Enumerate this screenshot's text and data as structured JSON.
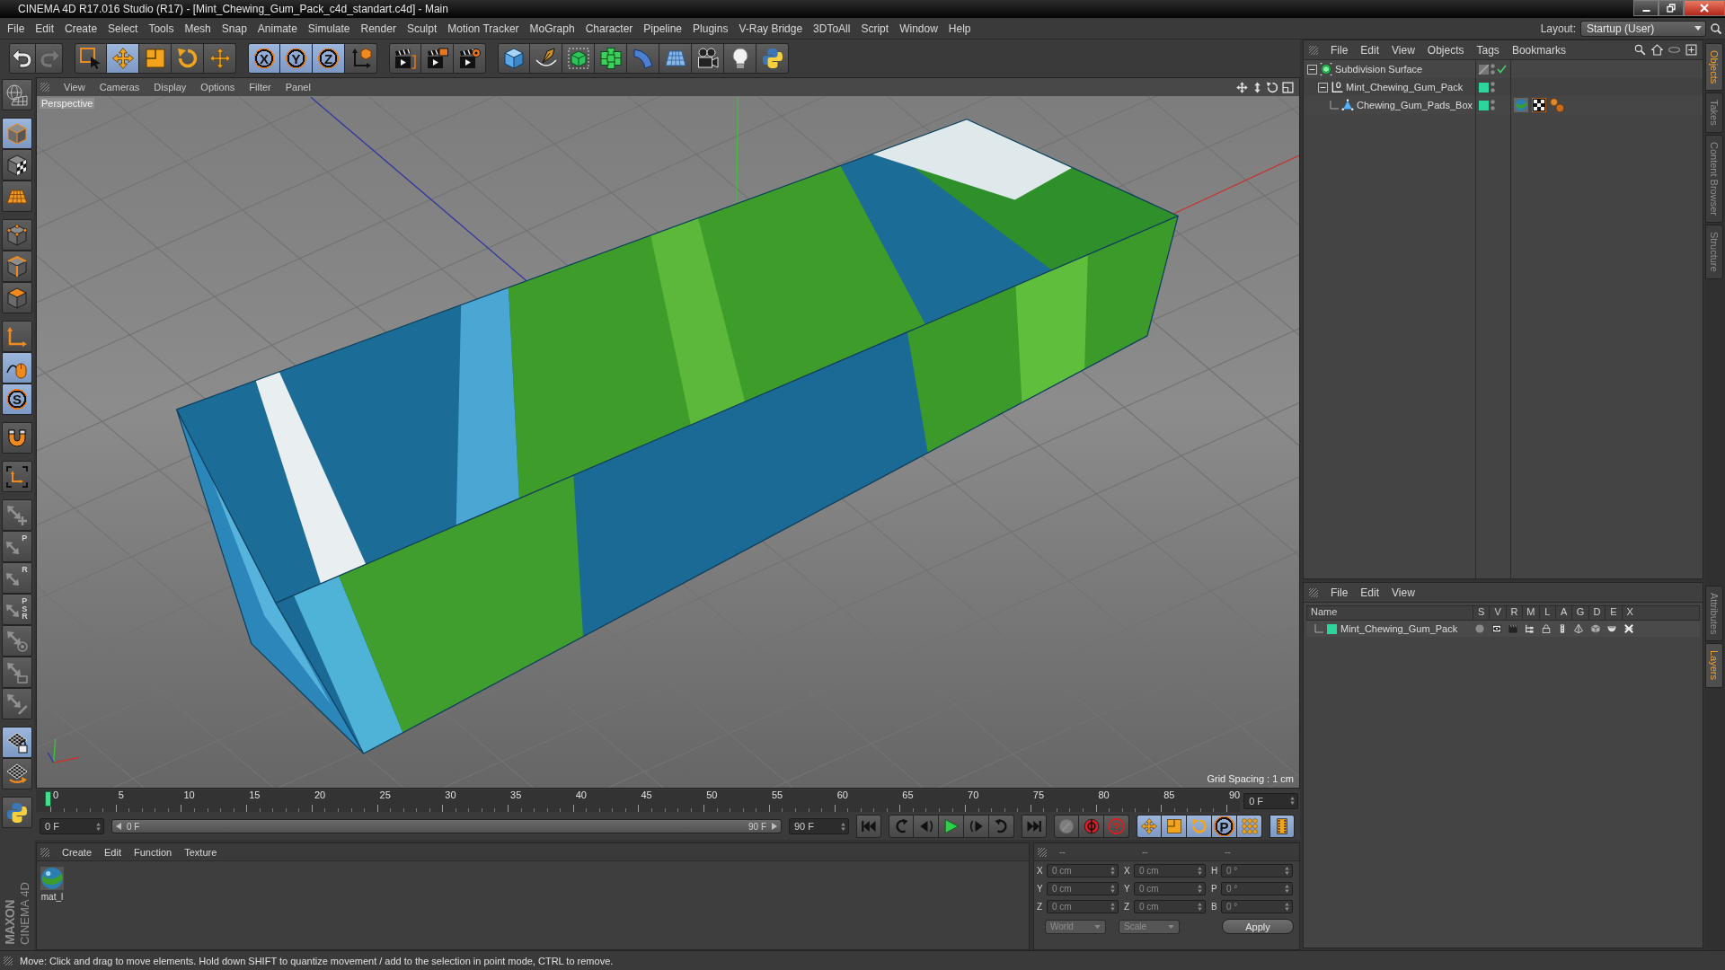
{
  "window": {
    "title": "CINEMA 4D R17.016 Studio (R17) - [Mint_Chewing_Gum_Pack_c4d_standart.c4d] - Main"
  },
  "menu_bar": [
    "File",
    "Edit",
    "Create",
    "Select",
    "Tools",
    "Mesh",
    "Snap",
    "Animate",
    "Simulate",
    "Render",
    "Sculpt",
    "Motion Tracker",
    "MoGraph",
    "Character",
    "Pipeline",
    "Plugins",
    "V-Ray Bridge",
    "3DToAll",
    "Script",
    "Window",
    "Help"
  ],
  "layout": {
    "label": "Layout:",
    "value": "Startup (User)"
  },
  "toolbar": [
    [
      {
        "kind": "undo",
        "selected": false,
        "disabled": false
      },
      {
        "kind": "redo",
        "selected": false,
        "disabled": true
      }
    ],
    [
      {
        "kind": "live-selection",
        "selected": false,
        "disabled": false
      },
      {
        "kind": "move",
        "selected": true,
        "disabled": false
      },
      {
        "kind": "scale",
        "selected": false,
        "disabled": false
      },
      {
        "kind": "rotate",
        "selected": false,
        "disabled": false
      },
      {
        "kind": "last-tool",
        "selected": false,
        "disabled": false
      }
    ],
    [
      {
        "kind": "axis-lock",
        "label": "X",
        "selected": true,
        "disabled": false
      },
      {
        "kind": "axis-lock",
        "label": "Y",
        "selected": true,
        "disabled": false
      },
      {
        "kind": "axis-lock",
        "label": "Z",
        "selected": true,
        "disabled": false
      },
      {
        "kind": "coordinate-system",
        "selected": false,
        "disabled": false
      }
    ],
    [
      {
        "kind": "render-view",
        "selected": false,
        "disabled": false
      },
      {
        "kind": "render-viewer",
        "selected": false,
        "disabled": false
      },
      {
        "kind": "render-settings",
        "selected": false,
        "disabled": false
      }
    ],
    [
      {
        "kind": "cube",
        "selected": false,
        "disabled": false
      },
      {
        "kind": "pen",
        "selected": false,
        "disabled": false
      },
      {
        "kind": "subdivision",
        "selected": false,
        "disabled": false
      },
      {
        "kind": "cloner",
        "selected": false,
        "disabled": false
      },
      {
        "kind": "bend",
        "selected": false,
        "disabled": false
      },
      {
        "kind": "floor",
        "selected": false,
        "disabled": false
      },
      {
        "kind": "camera",
        "selected": false,
        "disabled": false
      },
      {
        "kind": "light",
        "selected": false,
        "disabled": false
      },
      {
        "kind": "python",
        "selected": false,
        "disabled": false
      }
    ]
  ],
  "tool_palette": [
    [
      {
        "kind": "workplane-globe",
        "selected": false,
        "disabled": false
      }
    ],
    [
      {
        "kind": "model",
        "selected": true,
        "disabled": false
      },
      {
        "kind": "texture",
        "selected": false,
        "disabled": false
      },
      {
        "kind": "workplane",
        "selected": false,
        "disabled": false
      }
    ],
    [
      {
        "kind": "points",
        "selected": false,
        "disabled": false
      },
      {
        "kind": "edges",
        "selected": false,
        "disabled": false
      },
      {
        "kind": "polygons",
        "selected": false,
        "disabled": false
      }
    ],
    [
      {
        "kind": "axis",
        "selected": false,
        "disabled": false
      },
      {
        "kind": "tweak",
        "selected": true,
        "disabled": false
      },
      {
        "kind": "snap",
        "label": "S",
        "selected": true,
        "disabled": false
      }
    ],
    [
      {
        "kind": "magnet",
        "selected": false,
        "disabled": false
      }
    ],
    [
      {
        "kind": "axis-modify",
        "selected": false,
        "disabled": false
      }
    ],
    [
      {
        "kind": "quantize",
        "selected": false,
        "disabled": true
      },
      {
        "kind": "move-axis",
        "label": "P",
        "selected": false,
        "disabled": true
      },
      {
        "kind": "move-axis",
        "label": "R",
        "selected": false,
        "disabled": true
      },
      {
        "kind": "move-axis",
        "label": "PSR",
        "selected": false,
        "disabled": true
      },
      {
        "kind": "target-axis",
        "selected": false,
        "disabled": true
      },
      {
        "kind": "rect-axis",
        "selected": false,
        "disabled": true
      },
      {
        "kind": "brush-axis",
        "selected": false,
        "disabled": true
      }
    ],
    [
      {
        "kind": "lock-grid",
        "selected": true,
        "disabled": false
      },
      {
        "kind": "grid-rotate",
        "selected": false,
        "disabled": false
      }
    ],
    [
      {
        "kind": "python",
        "selected": false,
        "disabled": false
      }
    ]
  ],
  "viewport": {
    "menu": [
      "View",
      "Cameras",
      "Display",
      "Options",
      "Filter",
      "Panel"
    ],
    "camera": "Perspective",
    "grid_spacing": "Grid Spacing : 1 cm"
  },
  "timeline": {
    "ticks": [
      "0",
      "5",
      "10",
      "15",
      "20",
      "25",
      "30",
      "35",
      "40",
      "45",
      "50",
      "55",
      "60",
      "65",
      "70",
      "75",
      "80",
      "85",
      "90"
    ],
    "level": 0,
    "current_frame": "0 F"
  },
  "playback": {
    "start": "0 F",
    "range_start": "0 F",
    "range_end": "90 F",
    "end": "90 F",
    "buttons": [
      [
        {
          "kind": "go-start"
        }
      ],
      [
        {
          "kind": "prev-key"
        },
        {
          "kind": "prev-frame"
        },
        {
          "kind": "play"
        },
        {
          "kind": "next-frame"
        },
        {
          "kind": "next-key"
        }
      ],
      [
        {
          "kind": "go-end"
        }
      ],
      [
        {
          "kind": "autokey",
          "disabled": true
        },
        {
          "kind": "record",
          "disabled": false
        },
        {
          "kind": "record-help",
          "label": "?",
          "disabled": false
        }
      ],
      [
        {
          "kind": "key-position",
          "selected": true
        },
        {
          "kind": "key-scale",
          "selected": true
        },
        {
          "kind": "key-rotation",
          "selected": true
        },
        {
          "kind": "key-parameter",
          "label": "P",
          "selected": true
        },
        {
          "kind": "key-points",
          "selected": true
        }
      ],
      [
        {
          "kind": "timeline",
          "selected": true
        }
      ]
    ]
  },
  "materials": {
    "menu": [
      "Create",
      "Edit",
      "Function",
      "Texture"
    ],
    "items": [
      {
        "name": "mat_l"
      }
    ]
  },
  "coordinates": {
    "headers": [
      "--",
      "--",
      "--"
    ],
    "rows": [
      [
        {
          "axis": "X",
          "value": "0 cm"
        },
        {
          "axis": "X",
          "value": "0 cm"
        },
        {
          "axis": "H",
          "value": "0 °"
        }
      ],
      [
        {
          "axis": "Y",
          "value": "0 cm"
        },
        {
          "axis": "Y",
          "value": "0 cm"
        },
        {
          "axis": "P",
          "value": "0 °"
        }
      ],
      [
        {
          "axis": "Z",
          "value": "0 cm"
        },
        {
          "axis": "Z",
          "value": "0 cm"
        },
        {
          "axis": "B",
          "value": "0 °"
        }
      ]
    ],
    "space": "World",
    "mode": "Scale",
    "apply": "Apply"
  },
  "object_manager": {
    "menu": [
      "File",
      "Edit",
      "View",
      "Objects",
      "Tags",
      "Bookmarks"
    ],
    "objects": [
      {
        "name": "Subdivision Surface",
        "kind": "subdivision",
        "expanded": true,
        "enabled": true,
        "children": [
          {
            "name": "Mint_Chewing_Gum_Pack",
            "kind": "null",
            "color": "#2bd59b",
            "expanded": true,
            "children": [
              {
                "name": "Chewing_Gum_Pads_Box",
                "kind": "polygon",
                "color": "#2bd59b",
                "tags": [
                  {
                    "kind": "material"
                  },
                  {
                    "kind": "texture"
                  },
                  {
                    "kind": "phong"
                  }
                ]
              }
            ]
          }
        ]
      }
    ]
  },
  "layer_manager": {
    "menu": [
      "File",
      "Edit",
      "View"
    ],
    "columns": [
      "Name",
      "S",
      "V",
      "R",
      "M",
      "L",
      "A",
      "G",
      "D",
      "E",
      "X"
    ],
    "layers": [
      {
        "name": "Mint_Chewing_Gum_Pack",
        "color": "#2bd59b"
      }
    ]
  },
  "side_tabs_top": [
    {
      "label": "Objects",
      "selected": true
    },
    {
      "label": "Takes",
      "selected": false
    },
    {
      "label": "Content Browser",
      "selected": false
    },
    {
      "label": "Structure",
      "selected": false
    }
  ],
  "side_tabs_bottom": [
    {
      "label": "Attributes",
      "selected": false
    },
    {
      "label": "Layers",
      "selected": true
    }
  ],
  "logo": {
    "brand": "MAXON",
    "product": "CINEMA 4D"
  },
  "status_bar": "Move: Click and drag to move elements. Hold down SHIFT to quantize movement / add to the selection in point mode, CTRL to remove."
}
